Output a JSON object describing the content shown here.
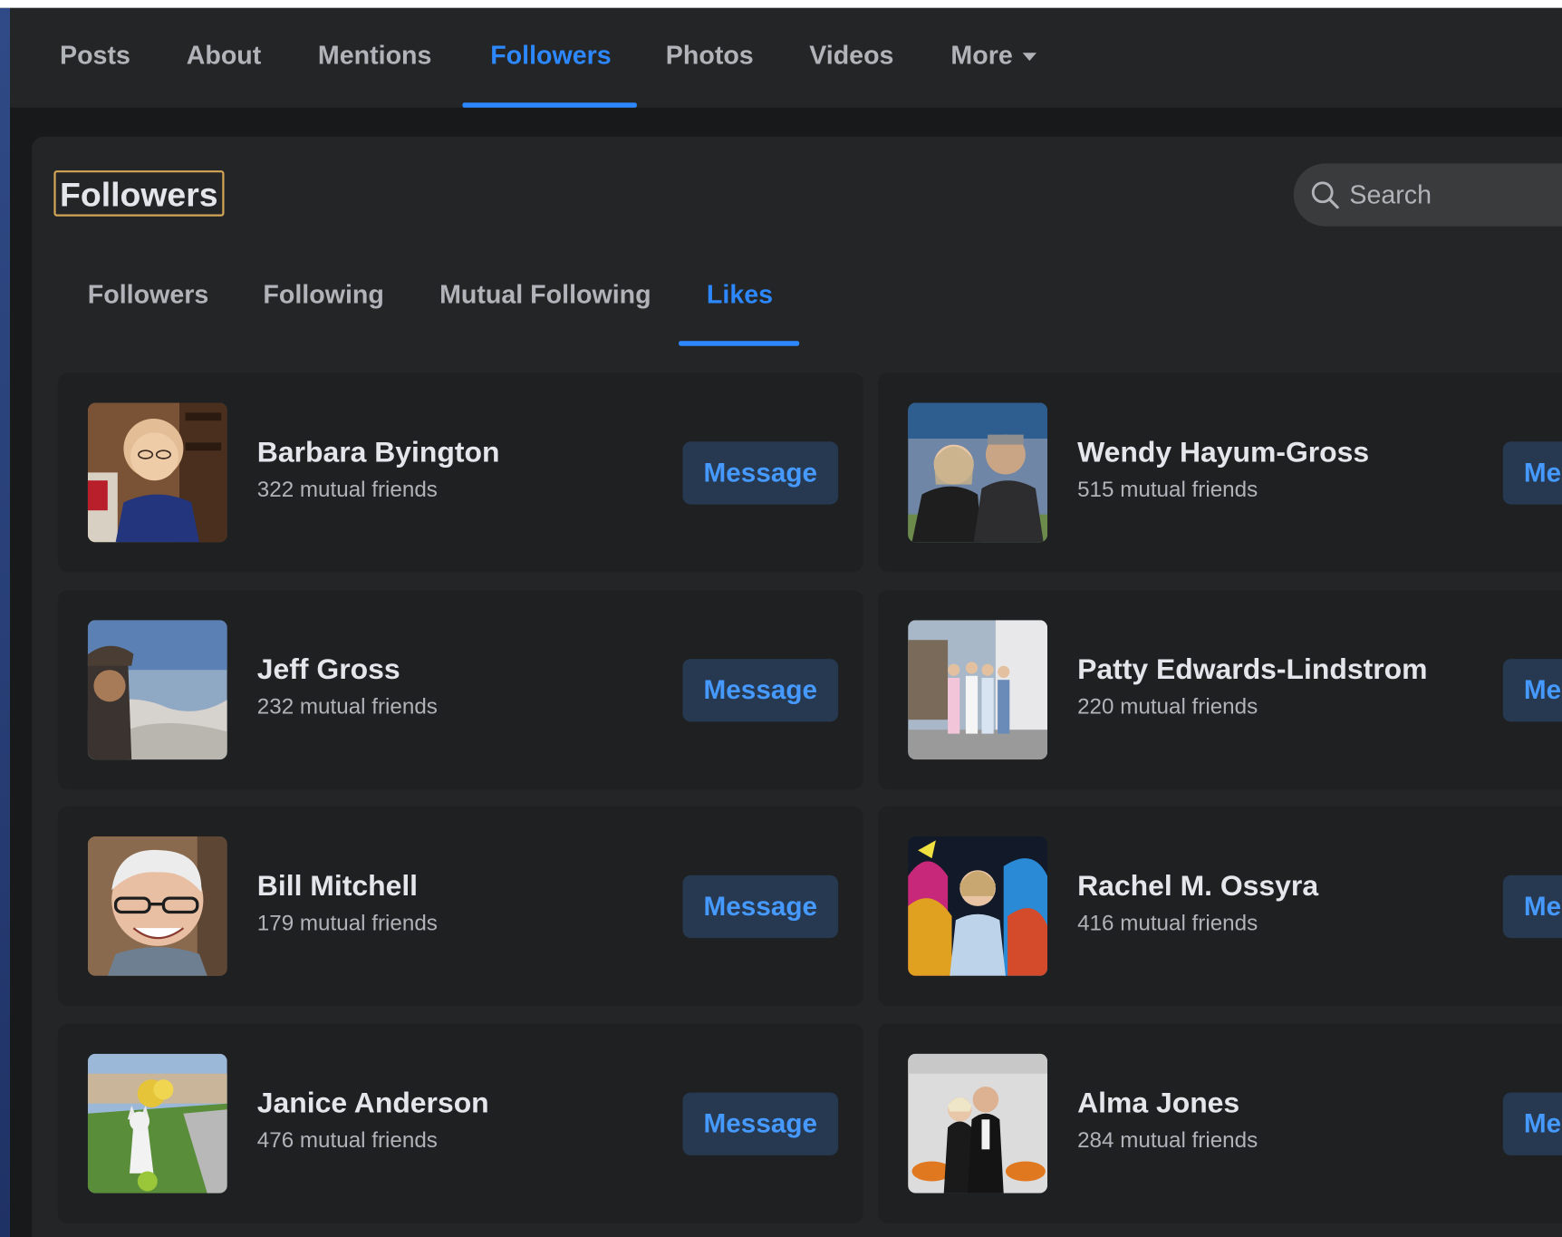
{
  "nav": {
    "tabs": [
      {
        "label": "Posts"
      },
      {
        "label": "About"
      },
      {
        "label": "Mentions"
      },
      {
        "label": "Followers"
      },
      {
        "label": "Photos"
      },
      {
        "label": "Videos"
      },
      {
        "label": "More"
      }
    ],
    "active_tab": "Followers"
  },
  "section": {
    "title": "Followers",
    "search_placeholder": "Search",
    "sub_tabs": [
      {
        "label": "Followers"
      },
      {
        "label": "Following"
      },
      {
        "label": "Mutual Following"
      },
      {
        "label": "Likes"
      }
    ],
    "active_sub_tab": "Likes"
  },
  "people": [
    {
      "name": "Barbara Byington",
      "mutual": "322 mutual friends",
      "button": "Message"
    },
    {
      "name": "Wendy Hayum-Gross",
      "mutual": "515 mutual friends",
      "button": "Message"
    },
    {
      "name": "Jeff Gross",
      "mutual": "232 mutual friends",
      "button": "Message"
    },
    {
      "name": "Patty Edwards-Lindstrom",
      "mutual": "220 mutual friends",
      "button": "Message"
    },
    {
      "name": "Bill Mitchell",
      "mutual": "179 mutual friends",
      "button": "Message"
    },
    {
      "name": "Rachel M. Ossyra",
      "mutual": "416 mutual friends",
      "button": "Message"
    },
    {
      "name": "Janice Anderson",
      "mutual": "476 mutual friends",
      "button": "Message"
    },
    {
      "name": "Alma Jones",
      "mutual": "284 mutual friends",
      "button": "Message"
    }
  ],
  "colors": {
    "background": "#18191a",
    "surface": "#242526",
    "card": "#1f2021",
    "accent": "#2d88ff",
    "text_primary": "#e4e6eb",
    "text_secondary": "#b0b3b8",
    "button_bg": "#263951",
    "title_outline": "#d4a657"
  }
}
